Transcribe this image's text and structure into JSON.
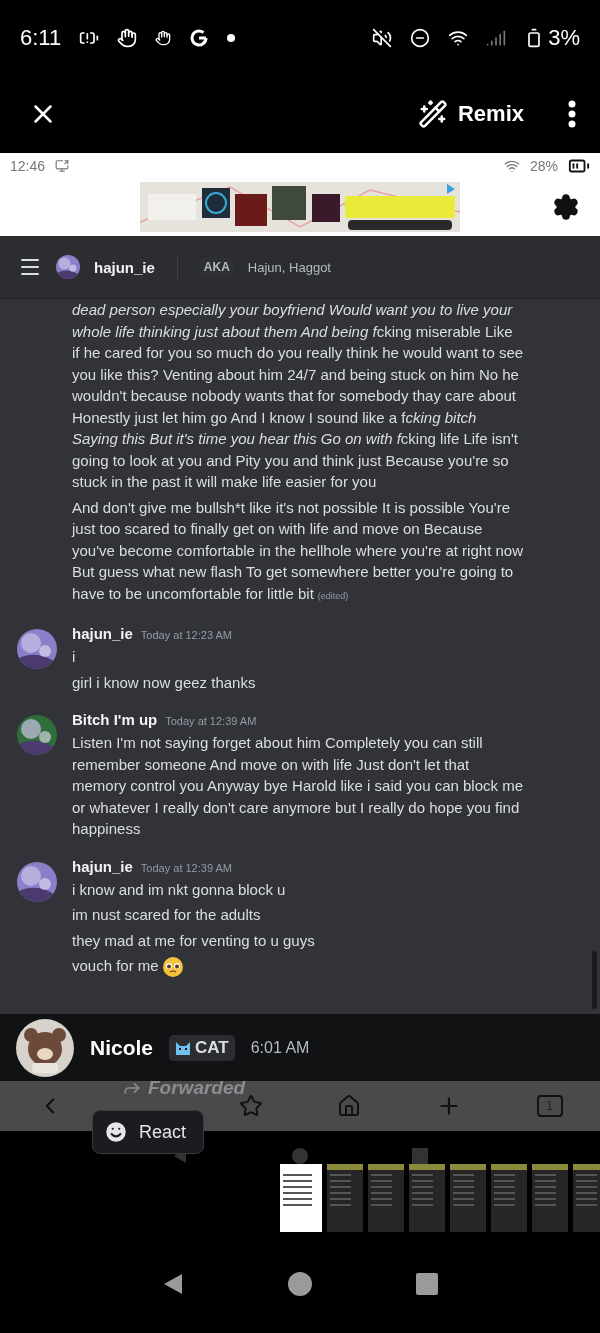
{
  "device_status": {
    "time": "6:11",
    "battery": "3%"
  },
  "viewer": {
    "action": "Remix"
  },
  "screenshot": {
    "status_bar": {
      "time": "12:46",
      "battery": "28%"
    },
    "channel_header": {
      "name": "hajun_ie",
      "aka_label": "AKA",
      "aka": "Hajun, Haggot"
    },
    "messages": [
      {
        "kind": "continuation",
        "lines": [
          {
            "segments": [
              {
                "text": "dead person especially your boyfriend Would want you to live your whole life thinking just about them And being f",
                "italic": true
              },
              {
                "text": "cking miserable Like if he cared for you so much do you really think he would want to see you like this? Venting about him 24/7 and being stuck on him No he wouldn't because nobody wants that for somebody thay care about Honestly just let him go And I know I sound like a f",
                "italic": false
              },
              {
                "text": "cking bitch Saying this But it's time you hear this Go on with f",
                "italic": true
              },
              {
                "text": "cking life Life isn't going to look at you and Pity you and think just Because you're so stuck in the past it will make life easier for you",
                "italic": false
              }
            ]
          },
          {
            "text": "And don't give me bullsh*t like it's not possible It is possible You're just too scared to finally get on with life and move on Because you've become comfortable in the hellhole where you're at right now But guess what new flash To get somewhere  better you're going to have to be uncomfortable for little bit",
            "edited": "(edited)"
          }
        ]
      },
      {
        "kind": "message",
        "author": "hajun_ie",
        "timestamp": "Today at 12:23 AM",
        "lines": [
          {
            "text": "i"
          },
          {
            "text": "girl i know now geez thanks"
          }
        ]
      },
      {
        "kind": "message",
        "author": "Bitch I'm up",
        "timestamp": "Today at 12:39 AM",
        "lines": [
          {
            "text": "Listen I'm not saying forget about him Completely you can still remember someone And move on with life Just don't let that memory control you Anyway bye Harold like i said you can block me or whatever I really don't care anymore but I really do hope you find happiness"
          }
        ]
      },
      {
        "kind": "message",
        "author": "hajun_ie",
        "timestamp": "Today at 12:39 AM",
        "lines": [
          {
            "text": "i know and im nkt gonna block u"
          },
          {
            "text": "im nust scared for the adults"
          },
          {
            "text": "they mad at me for venting to u guys"
          },
          {
            "text": "vouch for me",
            "emoji": true
          }
        ]
      }
    ],
    "browser_nav": {
      "tab_count": "1"
    }
  },
  "forward_overlay": {
    "author": "Nicole",
    "badge": "CAT",
    "time": "6:01 AM",
    "forwarded_label": "Forwarded",
    "react_label": "React"
  },
  "thumbnails": [
    {
      "selected": true
    },
    {
      "selected": false
    },
    {
      "selected": false
    },
    {
      "selected": false
    },
    {
      "selected": false
    },
    {
      "selected": false
    },
    {
      "selected": false
    },
    {
      "selected": false
    }
  ]
}
